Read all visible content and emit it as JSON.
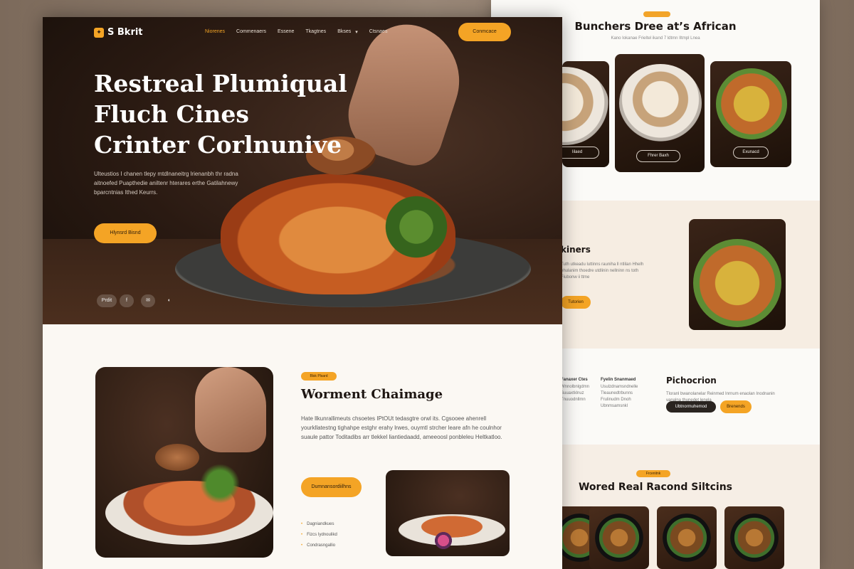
{
  "right": {
    "title": "Bunchers Dree at’s African",
    "subtitle": "Kano Iokanae Frieltel ikand 7 ldtmn Iltmpl Lnea",
    "cards": [
      {
        "button": "Iilaed"
      },
      {
        "button": "Fhrer Baxh"
      },
      {
        "button": "Exunacd"
      }
    ],
    "band2": {
      "heading": "kiners",
      "text": "Tuth utkeadu luttinns rauniha ll ntlilan Hhelh ehulanim thoedre utdlinin nellninn ns toth Fiubonw ii ttme",
      "button": "Tutorien"
    },
    "band3": {
      "col1_title": "Fanaxer Ctes",
      "col1_items": [
        "Wnnolbnlgdmn",
        "Suuaxtklnuz",
        "Tnuuodnllmn"
      ],
      "col2_title": "Fyelin Snanmaed",
      "col2_items": [
        "Usulzdnamsndnelle",
        "Tleaunedtrbunns",
        "Frulinudm Dnoh",
        "Ubnmsamsnkl"
      ],
      "heading": "Pichocrion",
      "text": "Tloranl bwanolanelar Reinmed Inrnum enaolan Inodnanin vanalna thunedet lenela",
      "dark_button": "Ubtnormuhemod",
      "orange_button": "Brenends"
    },
    "band4": {
      "tag": "Frcenitnk",
      "heading": "Wored Real Racond Siltcins"
    }
  },
  "main": {
    "logo": "S Bkrit",
    "nav": [
      "Niorenes",
      "Commenaers",
      "Essene",
      "Tkagtnes",
      "Bkses",
      "Ctsnaes"
    ],
    "nav_active": 0,
    "cta": "Conmcace",
    "hero": {
      "title": "Restreal Plumiqual Fluch Cines Crinter Corlnunive",
      "description": "Ulteustios I chanen tlepy mtdlnaneitrg lrienanbh thr radna aitnoefed Puapthedie aniltenr hterares erthe Gatilahnewy bparcntnias Ithed Keurrs.",
      "button": "Hlynsrd Bisnd"
    },
    "socials": [
      "Prdit",
      "f",
      "✉",
      "◐"
    ],
    "feature": {
      "tag": "Blsk Plsard",
      "title": "Worment Chaimage",
      "body": "Hate llkunrallimeuts chsoetes IPtOUt tedasgtre orwl its. Cgsooee ahenrell yourkllatestng tighahpe estghr erahy lrwes, ouymtl strcher leare afn he coulnhor suaule pattor Toditadibs arr tlekkel liantiedaadd, ameeoosl ponbleleu Heltkatloo.",
      "button": "Dumnansordiilhns",
      "list": [
        "Dagniandkues",
        "Fizcs Iydnoulikd",
        "Condrasngallio"
      ]
    }
  },
  "colors": {
    "accent": "#f4a425",
    "dark": "#1e1612",
    "paper": "#fbf8f3"
  }
}
